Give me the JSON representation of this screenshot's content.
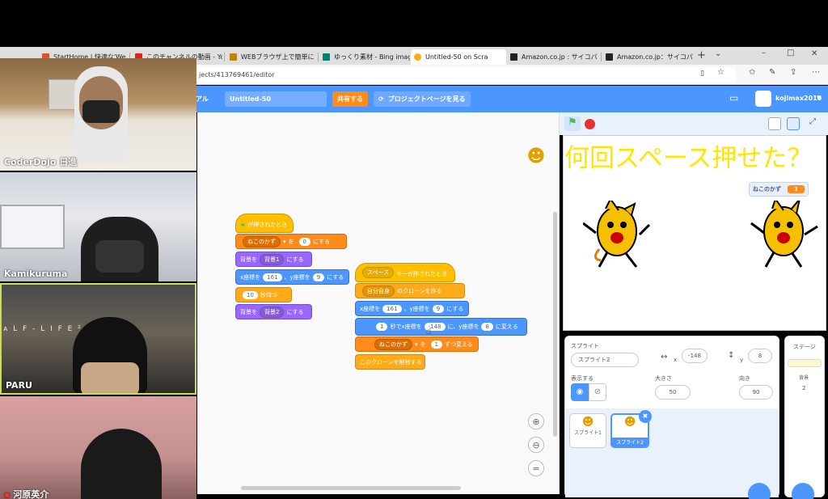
{
  "browser": {
    "tabs": [
      {
        "label": "StartHome | 快適な'We",
        "color": "#e0522b"
      },
      {
        "label": "このチャンネルの動画 - Yo",
        "color": "#e62117"
      },
      {
        "label": "WEBブラウザ上で簡単に",
        "color": "#b8860b"
      },
      {
        "label": "ゆっくり素材 - Bing imag",
        "color": "#008373"
      },
      {
        "label": "Untitled-50 on Scra",
        "color": "#ffab19"
      },
      {
        "label": "Amazon.co.jp : サイコパ",
        "color": "#222222"
      },
      {
        "label": "Amazon.co.jp：サイコパ",
        "color": "#222222"
      }
    ],
    "new_tab": "+",
    "tab_menu": "⌄",
    "minimize": "–",
    "maximize": "□",
    "close": "✕",
    "url": "jects/413769461/editor"
  },
  "scratch": {
    "menu_partial": "アル",
    "project_title": "Untitled-50",
    "share_label": "共有する",
    "project_page_label": "プロジェクトページを見る",
    "username": "kojimax2010",
    "stage_text": "何回スペース押せた？",
    "variable_name": "ねこのかず",
    "variable_value": "1",
    "script1": {
      "hat": "が押されたとき",
      "set_var": {
        "var": "ねこのかず",
        "to": "を",
        "value": "0",
        "suffix": "にする"
      },
      "backdrop1": {
        "prefix": "背景を",
        "value": "背景1",
        "suffix": "にする"
      },
      "goto": {
        "x_label": "x座標を",
        "x": "161",
        "y_label": "、y座標を",
        "y": "9",
        "suffix": "にする"
      },
      "wait": {
        "value": "10",
        "suffix": "秒待つ"
      },
      "backdrop2": {
        "prefix": "背景を",
        "value": "背景2",
        "suffix": "にする"
      }
    },
    "script2": {
      "hat_key": "スペース",
      "hat_suffix": "キーが押されたとき",
      "clone": {
        "value": "自分自身",
        "suffix": "のクローンを作る"
      },
      "goto": {
        "x_label": "x座標を",
        "x": "161",
        "y_label": "、y座標を",
        "y": "9",
        "suffix": "にする"
      },
      "glide": {
        "secs": "1",
        "x_label": "秒でx座標を",
        "x": "-148",
        "y_label": "に、y座標を",
        "y": "8",
        "suffix": "に変える"
      },
      "change": {
        "var": "ねこのかず",
        "by_label": "を",
        "value": "1",
        "suffix": "ずつ変える"
      },
      "delete": "このクローンを削除する"
    },
    "sprite_panel": {
      "label": "スプライト",
      "name": "スプライト2",
      "x_label": "x",
      "x": "-148",
      "y_label": "y",
      "y": "8",
      "show_label": "表示する",
      "size_label": "大きさ",
      "size": "50",
      "direction_label": "向き",
      "direction": "90",
      "sprites": [
        "スプライト1",
        "スプライト2"
      ]
    },
    "stage_panel": {
      "label": "ステージ",
      "backdrops_label": "背景",
      "backdrops_count": "2"
    },
    "zoom_reset": "="
  },
  "participants": [
    {
      "name": "CoderDojo 日進"
    },
    {
      "name": "Kamikuruma"
    },
    {
      "name": "PARU"
    },
    {
      "name": "河原英介"
    }
  ],
  "colors": {
    "scratch_blue": "#4c97ff",
    "orange": "#ff8c1a",
    "stage_text": "#ffe600"
  }
}
